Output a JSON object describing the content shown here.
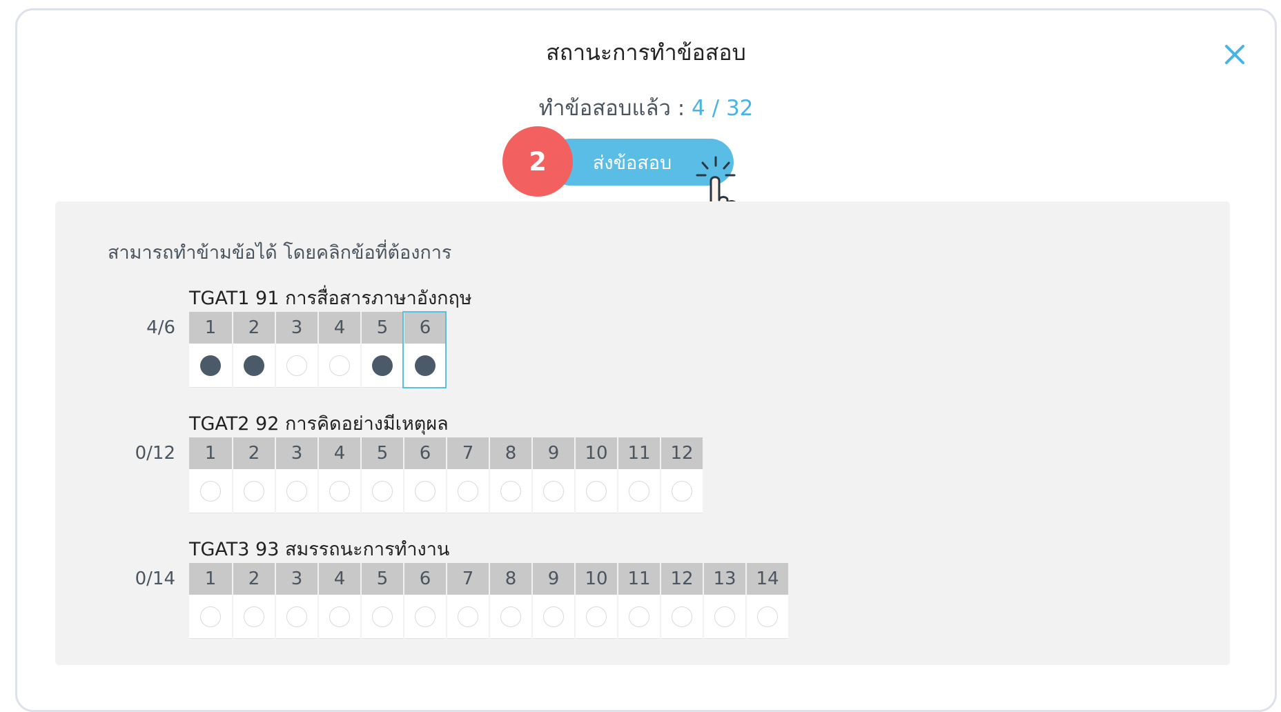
{
  "modal": {
    "title": "สถานะการทำข้อสอบ",
    "close_icon": "close-icon",
    "progress_label": "ทำข้อสอบแล้ว",
    "progress_separator": ":",
    "progress_done": "4",
    "progress_slash": "/",
    "progress_total": "32",
    "submit_label": "ส่งข้อสอบ",
    "step_badge": "2",
    "pointer_icon": "hand-pointer-icon"
  },
  "panel": {
    "hint": "สามารถทำข้ามข้อได้ โดยคลิกข้อที่ต้องการ",
    "sections": [
      {
        "title": "TGAT1 91 การสื่อสารภาษาอังกฤษ",
        "count": "4/6",
        "questions": [
          {
            "num": "1",
            "answered": true
          },
          {
            "num": "2",
            "answered": true
          },
          {
            "num": "3",
            "answered": false
          },
          {
            "num": "4",
            "answered": false
          },
          {
            "num": "5",
            "answered": true
          },
          {
            "num": "6",
            "answered": true,
            "current": true
          }
        ]
      },
      {
        "title": "TGAT2 92 การคิดอย่างมีเหตุผล",
        "count": "0/12",
        "questions": [
          {
            "num": "1",
            "answered": false
          },
          {
            "num": "2",
            "answered": false
          },
          {
            "num": "3",
            "answered": false
          },
          {
            "num": "4",
            "answered": false
          },
          {
            "num": "5",
            "answered": false
          },
          {
            "num": "6",
            "answered": false
          },
          {
            "num": "7",
            "answered": false
          },
          {
            "num": "8",
            "answered": false
          },
          {
            "num": "9",
            "answered": false
          },
          {
            "num": "10",
            "answered": false
          },
          {
            "num": "11",
            "answered": false
          },
          {
            "num": "12",
            "answered": false
          }
        ]
      },
      {
        "title": "TGAT3 93 สมรรถนะการทำงาน",
        "count": "0/14",
        "questions": [
          {
            "num": "1",
            "answered": false
          },
          {
            "num": "2",
            "answered": false
          },
          {
            "num": "3",
            "answered": false
          },
          {
            "num": "4",
            "answered": false
          },
          {
            "num": "5",
            "answered": false
          },
          {
            "num": "6",
            "answered": false
          },
          {
            "num": "7",
            "answered": false
          },
          {
            "num": "8",
            "answered": false
          },
          {
            "num": "9",
            "answered": false
          },
          {
            "num": "10",
            "answered": false
          },
          {
            "num": "11",
            "answered": false
          },
          {
            "num": "12",
            "answered": false
          },
          {
            "num": "13",
            "answered": false
          },
          {
            "num": "14",
            "answered": false
          }
        ]
      }
    ]
  },
  "colors": {
    "accent": "#59bde6",
    "badge": "#f2605f",
    "answered_dot": "#4a5a68",
    "panel_bg": "#f2f2f2"
  }
}
